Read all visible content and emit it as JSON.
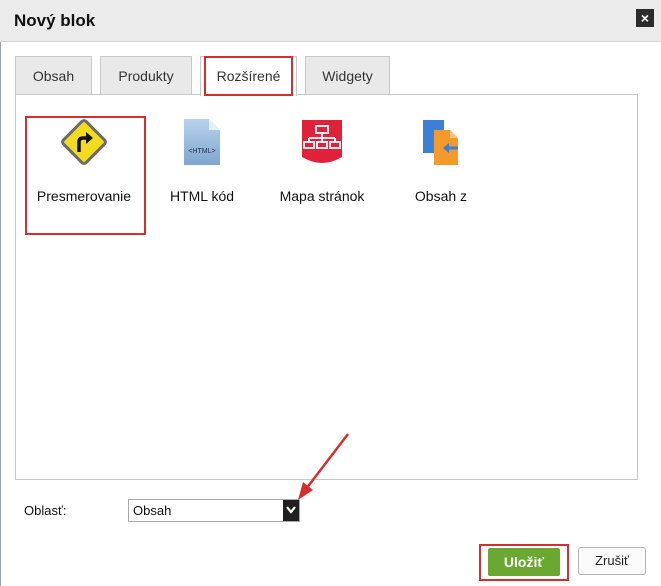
{
  "dialog": {
    "title": "Nový blok",
    "close_icon": "×"
  },
  "tabs": [
    {
      "label": "Obsah",
      "active": false
    },
    {
      "label": "Produkty",
      "active": false
    },
    {
      "label": "Rozšírené",
      "active": true
    },
    {
      "label": "Widgety",
      "active": false
    }
  ],
  "items": [
    {
      "label": "Presmerovanie",
      "icon": "redirect-sign-icon"
    },
    {
      "label": "HTML kód",
      "icon": "html-file-icon",
      "icon_text": "<HTML>"
    },
    {
      "label": "Mapa stránok",
      "icon": "sitemap-icon"
    },
    {
      "label": "Obsah z",
      "icon": "content-from-icon"
    }
  ],
  "area": {
    "label": "Oblasť:",
    "selected": "Obsah"
  },
  "buttons": {
    "save": "Uložiť",
    "cancel": "Zrušiť"
  },
  "colors": {
    "highlight": "#d62e2e",
    "save": "#6aa832",
    "redirect_sign": "#f2dc1f",
    "sitemap": "#e0213a",
    "content_from": "#f39a2a"
  }
}
